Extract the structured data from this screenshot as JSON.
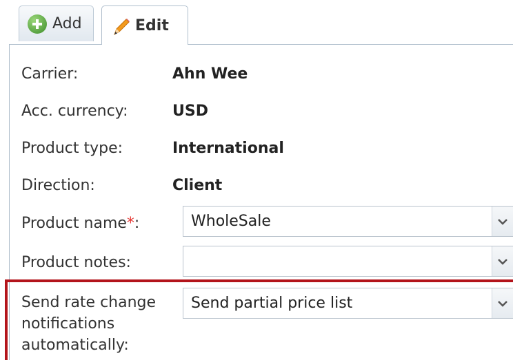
{
  "tabs": [
    {
      "label": "Add",
      "icon": "plus-icon"
    },
    {
      "label": "Edit",
      "icon": "pencil-icon"
    }
  ],
  "form": {
    "carrier_label": "Carrier:",
    "carrier_value": "Ahn Wee",
    "currency_label": "Acc. currency:",
    "currency_value": "USD",
    "product_type_label": "Product type:",
    "product_type_value": "International",
    "direction_label": "Direction:",
    "direction_value": "Client",
    "product_name_label": "Product name",
    "product_name_required": "*",
    "product_name_colon": ":",
    "product_name_value": "WholeSale",
    "product_notes_label": "Product notes:",
    "product_notes_value": "",
    "notify_label_line1": "Send rate change",
    "notify_label_line2": "notifications",
    "notify_label_line3": "automatically:",
    "notify_value": "Send partial price list"
  },
  "colors": {
    "highlight_border": "#b3141b",
    "required_marker": "#e53935",
    "tab_border": "#aebdcb"
  }
}
